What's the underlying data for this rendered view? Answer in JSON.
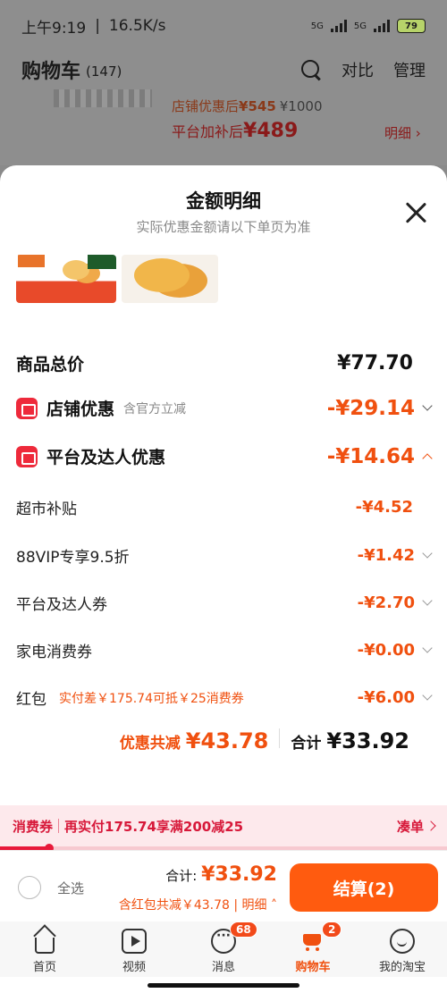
{
  "status": {
    "time": "上午9:19",
    "speed": "16.5K/s",
    "network1": "5G",
    "network2": "5G",
    "battery": "79"
  },
  "header": {
    "title": "购物车",
    "count": "(147)",
    "compare": "对比",
    "manage": "管理"
  },
  "bg_item": {
    "after_shop_label": "店铺优惠后",
    "after_shop_price": "¥545",
    "orig_price": "¥1000",
    "after_platform_label": "平台加补后",
    "after_platform_price": "¥489",
    "detail": "明细"
  },
  "sheet": {
    "title": "金额明细",
    "subtitle": "实际优惠金额请以下单页为准",
    "rows": {
      "total_label": "商品总价",
      "total_value": "¥77.70",
      "shop_label": "店铺优惠",
      "shop_note": "含官方立减",
      "shop_value": "-¥29.14",
      "platform_label": "平台及达人优惠",
      "platform_value": "-¥14.64",
      "super_label": "超市补贴",
      "super_value": "-¥4.52",
      "vip_label": "88VIP专享9.5折",
      "vip_value": "-¥1.42",
      "coupon_label": "平台及达人券",
      "coupon_value": "-¥2.70",
      "appliance_label": "家电消费券",
      "appliance_value": "-¥0.00",
      "redpack_label": "红包",
      "redpack_note": "实付差￥175.74可抵￥25消费券",
      "redpack_value": "-¥6.00"
    },
    "summary": {
      "discount_label": "优惠共减",
      "discount_value": "¥43.78",
      "total_label": "合计",
      "total_value": "¥33.92"
    }
  },
  "banner": {
    "label": "消费券",
    "text": "再实付175.74享满200减25",
    "action": "凑单",
    "progress": 0.11
  },
  "checkout": {
    "select_all": "全选",
    "total_label": "合计:",
    "total_value": "¥33.92",
    "note": "含红包共减￥43.78 | 明细",
    "pay_button": "结算(2)"
  },
  "tabs": [
    {
      "label": "首页",
      "icon": "home-icon"
    },
    {
      "label": "视频",
      "icon": "video-icon"
    },
    {
      "label": "消息",
      "icon": "message-icon",
      "badge": "68"
    },
    {
      "label": "购物车",
      "icon": "cart-icon",
      "badge": "2"
    },
    {
      "label": "我的淘宝",
      "icon": "profile-icon"
    }
  ],
  "colors": {
    "accent": "#f0500f",
    "pay_button": "#ff5b0f",
    "banner_red": "#d7193a"
  }
}
